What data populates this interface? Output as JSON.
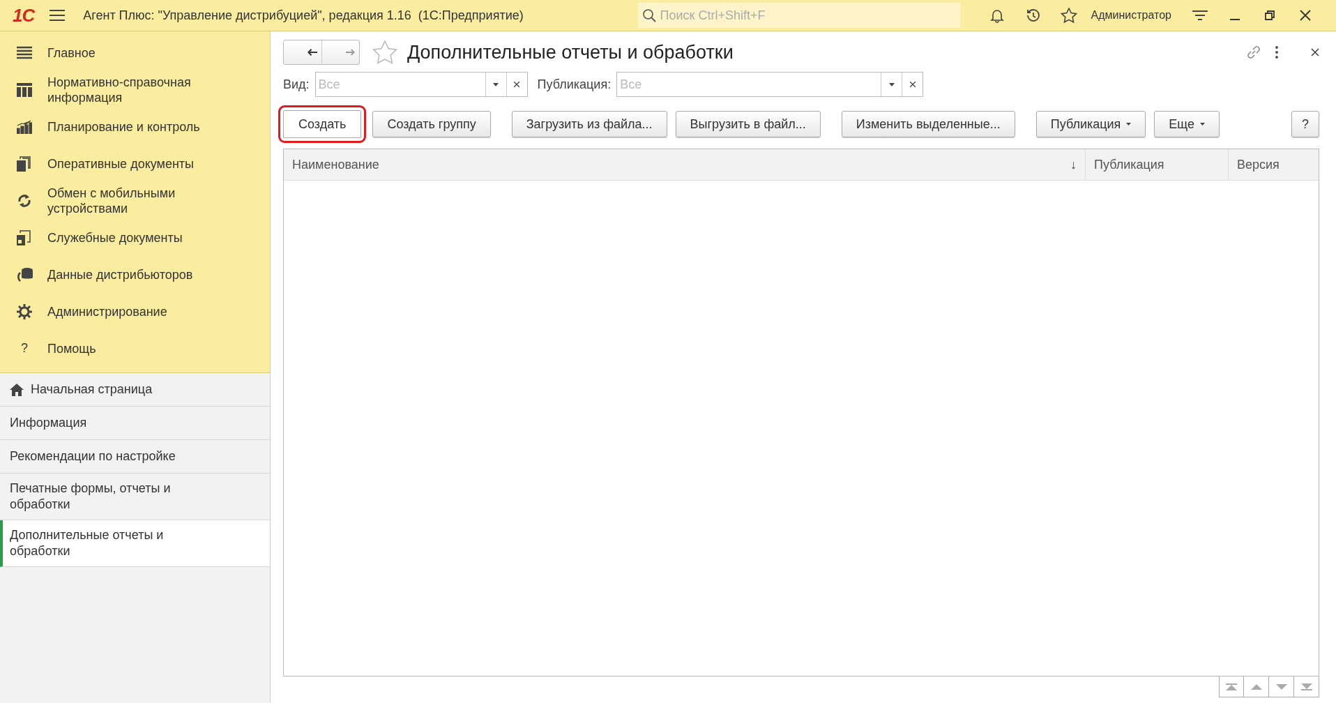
{
  "top_bar": {
    "logo": "1С",
    "title": "Агент Плюс: \"Управление дистрибуцией\", редакция 1.16  (1С:Предприятие)",
    "search": {
      "placeholder": "Поиск Ctrl+Shift+F"
    },
    "user": "Администратор"
  },
  "sections": [
    {
      "label": "Главное"
    },
    {
      "label": "Нормативно-справочная информация"
    },
    {
      "label": "Планирование и контроль"
    },
    {
      "label": "Оперативные документы"
    },
    {
      "label": "Обмен с мобильными устройствами"
    },
    {
      "label": "Служебные документы"
    },
    {
      "label": "Данные дистрибьюторов"
    },
    {
      "label": "Администрирование"
    },
    {
      "label": "Помощь",
      "glyph": "?"
    }
  ],
  "open_windows": [
    {
      "kind": "home",
      "label": "Начальная страница",
      "selected": false
    },
    {
      "kind": "plain",
      "label": "Информация",
      "selected": false
    },
    {
      "kind": "plain",
      "label": "Рекомендации по настройке",
      "selected": false
    },
    {
      "kind": "plain",
      "label": "Печатные формы, отчеты и обработки",
      "selected": false
    },
    {
      "kind": "plain",
      "label": "Дополнительные отчеты и обработки",
      "selected": true
    }
  ],
  "form": {
    "title": "Дополнительные отчеты и обработки",
    "filters": [
      {
        "label": "Вид:",
        "placeholder": "Все"
      },
      {
        "label": "Публикация:",
        "placeholder": "Все"
      }
    ],
    "buttons": [
      {
        "label": "Создать",
        "dropdown": false,
        "highlighted": true
      },
      {
        "label": "Создать группу",
        "dropdown": false,
        "highlighted": false
      },
      {
        "label": "Загрузить из файла...",
        "dropdown": false,
        "highlighted": false
      },
      {
        "label": "Выгрузить в файл...",
        "dropdown": false,
        "highlighted": false
      },
      {
        "label": "Изменить выделенные...",
        "dropdown": false,
        "highlighted": false
      },
      {
        "label": "Публикация",
        "dropdown": true,
        "highlighted": false
      },
      {
        "label": "Еще",
        "dropdown": true,
        "highlighted": false
      },
      {
        "label": "?",
        "dropdown": false,
        "highlighted": false
      }
    ],
    "columns": [
      {
        "label": "Наименование",
        "sort": "↓"
      },
      {
        "label": "Публикация"
      },
      {
        "label": "Версия"
      }
    ]
  }
}
